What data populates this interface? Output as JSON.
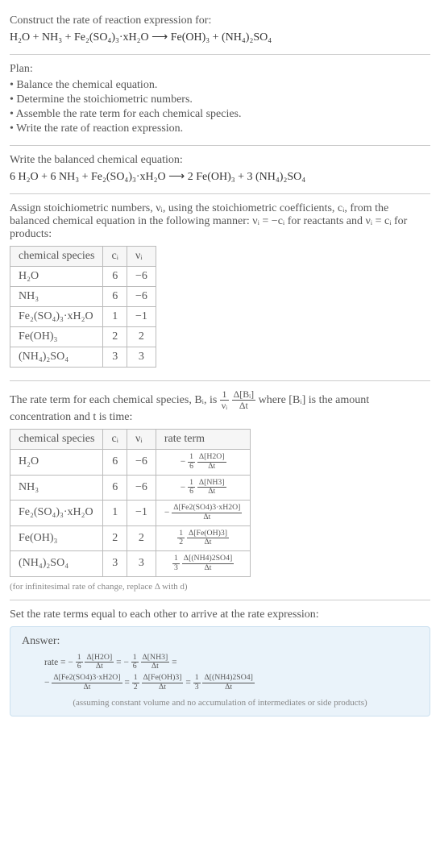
{
  "section_construct": {
    "title": "Construct the rate of reaction expression for:",
    "equation": "H₂O + NH₃ + Fe₂(SO₄)₃·xH₂O ⟶ Fe(OH)₃ + (NH₄)₂SO₄"
  },
  "section_plan": {
    "title": "Plan:",
    "items": [
      "• Balance the chemical equation.",
      "• Determine the stoichiometric numbers.",
      "• Assemble the rate term for each chemical species.",
      "• Write the rate of reaction expression."
    ]
  },
  "section_balanced": {
    "title": "Write the balanced chemical equation:",
    "equation": "6 H₂O + 6 NH₃ + Fe₂(SO₄)₃·xH₂O ⟶ 2 Fe(OH)₃ + 3 (NH₄)₂SO₄"
  },
  "section_stoich": {
    "intro": "Assign stoichiometric numbers, νᵢ, using the stoichiometric coefficients, cᵢ, from the balanced chemical equation in the following manner: νᵢ = −cᵢ for reactants and νᵢ = cᵢ for products:",
    "headers": {
      "species": "chemical species",
      "c": "cᵢ",
      "v": "νᵢ"
    },
    "rows": [
      {
        "species": "H₂O",
        "c": "6",
        "v": "−6"
      },
      {
        "species": "NH₃",
        "c": "6",
        "v": "−6"
      },
      {
        "species": "Fe₂(SO₄)₃·xH₂O",
        "c": "1",
        "v": "−1"
      },
      {
        "species": "Fe(OH)₃",
        "c": "2",
        "v": "2"
      },
      {
        "species": "(NH₄)₂SO₄",
        "c": "3",
        "v": "3"
      }
    ]
  },
  "section_rateterm": {
    "intro_a": "The rate term for each chemical species, Bᵢ, is ",
    "intro_b": " where [Bᵢ] is the amount concentration and t is time:",
    "frac_left_num": "1",
    "frac_left_den": "νᵢ",
    "frac_right_num": "Δ[Bᵢ]",
    "frac_right_den": "Δt",
    "headers": {
      "species": "chemical species",
      "c": "cᵢ",
      "v": "νᵢ",
      "rate": "rate term"
    },
    "rows": [
      {
        "species": "H₂O",
        "c": "6",
        "v": "−6",
        "coef_num": "1",
        "coef_den": "6",
        "sign": "−",
        "delta_num": "Δ[H2O]",
        "delta_den": "Δt"
      },
      {
        "species": "NH₃",
        "c": "6",
        "v": "−6",
        "coef_num": "1",
        "coef_den": "6",
        "sign": "−",
        "delta_num": "Δ[NH3]",
        "delta_den": "Δt"
      },
      {
        "species": "Fe₂(SO₄)₃·xH₂O",
        "c": "1",
        "v": "−1",
        "coef_num": "",
        "coef_den": "",
        "sign": "−",
        "delta_num": "Δ[Fe2(SO4)3·xH2O]",
        "delta_den": "Δt"
      },
      {
        "species": "Fe(OH)₃",
        "c": "2",
        "v": "2",
        "coef_num": "1",
        "coef_den": "2",
        "sign": "",
        "delta_num": "Δ[Fe(OH)3]",
        "delta_den": "Δt"
      },
      {
        "species": "(NH₄)₂SO₄",
        "c": "3",
        "v": "3",
        "coef_num": "1",
        "coef_den": "3",
        "sign": "",
        "delta_num": "Δ[(NH4)2SO4]",
        "delta_den": "Δt"
      }
    ],
    "note": "(for infinitesimal rate of change, replace Δ with d)"
  },
  "section_final": {
    "title": "Set the rate terms equal to each other to arrive at the rate expression:",
    "answer_label": "Answer:",
    "rate_prefix": "rate = ",
    "eq": " = ",
    "neg": "−",
    "terms": [
      {
        "sign": "−",
        "coef_num": "1",
        "coef_den": "6",
        "delta_num": "Δ[H2O]",
        "delta_den": "Δt"
      },
      {
        "sign": "−",
        "coef_num": "1",
        "coef_den": "6",
        "delta_num": "Δ[NH3]",
        "delta_den": "Δt"
      },
      {
        "sign": "−",
        "coef_num": "",
        "coef_den": "",
        "delta_num": "Δ[Fe2(SO4)3·xH2O]",
        "delta_den": "Δt"
      },
      {
        "sign": "",
        "coef_num": "1",
        "coef_den": "2",
        "delta_num": "Δ[Fe(OH)3]",
        "delta_den": "Δt"
      },
      {
        "sign": "",
        "coef_num": "1",
        "coef_den": "3",
        "delta_num": "Δ[(NH4)2SO4]",
        "delta_den": "Δt"
      }
    ],
    "answer_note": "(assuming constant volume and no accumulation of intermediates or side products)"
  }
}
